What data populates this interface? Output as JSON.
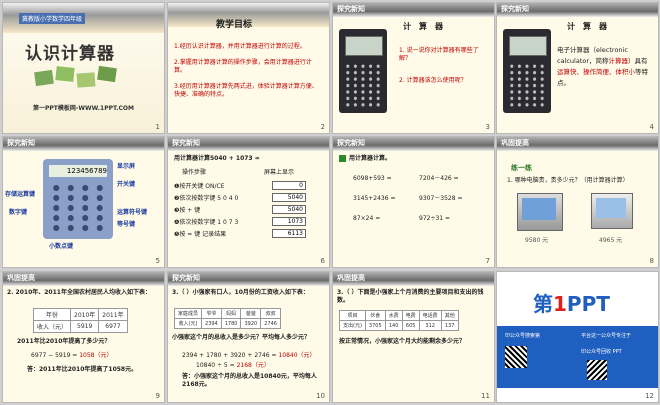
{
  "slides": [
    {
      "num": "1",
      "badge": "冀教版小学数学四年级",
      "title": "认识计算器",
      "footer": "第一PPT模板网-WWW.1PPT.COM"
    },
    {
      "num": "2",
      "title": "教学目标",
      "items": [
        "1.经历认识计算器，并用计算器进行计算的过程。",
        "2.掌握用计算器计算的操作步骤，会用计算器进行计算。",
        "3.经历用计算器计算先两式进，体验计算器计算方便、快捷、准确的特点。"
      ]
    },
    {
      "num": "3",
      "hdr": "探究新知",
      "title": "计　算　器",
      "q1": "1. 说一说你对计算器有哪些了解？",
      "q2": "2. 计算器该怎么使用呢？"
    },
    {
      "num": "4",
      "hdr": "探究新知",
      "title": "计　算　器",
      "text_a": "电子计算器（electronic calculator，简称",
      "text_b": "计算器",
      "text_c": "）具有",
      "text_d": "运算快、操作简便、体积小",
      "text_e": "等特点。"
    },
    {
      "num": "5",
      "hdr": "探究新知",
      "display": "123456789",
      "labels": {
        "screen": "显示屏",
        "power": "开关键",
        "memory": "存储运算键",
        "digit": "数字键",
        "op": "运算符号键",
        "eq": "等号键",
        "dot": "小数点键"
      }
    },
    {
      "num": "6",
      "hdr": "探究新知",
      "title": "用计算器计算5040 + 1073 =",
      "col1": "操作步骤",
      "col2": "屏幕上显示",
      "steps": [
        "❶按开关键 ON/CE",
        "❷依次按数字键 5 0 4 0",
        "❸按 + 键",
        "❹依次按数字键 1 0 7 3",
        "❺按 = 键 记录结果"
      ],
      "screens": [
        "0",
        "5040",
        "5040",
        "1073",
        "6113"
      ]
    },
    {
      "num": "7",
      "hdr": "探究新知",
      "sub": "用计算器计算。",
      "exprs": [
        "6098+593 =",
        "7204－426 =",
        "3145+2436 =",
        "9307－3528 =",
        "87×24 =",
        "972÷31 ="
      ]
    },
    {
      "num": "8",
      "hdr": "巩固提高",
      "sub": "练一练",
      "q": "1. 哪种电脑贵，贵多少元？（用计算器计算）",
      "prices": [
        "9580 元",
        "4965 元"
      ]
    },
    {
      "num": "9",
      "hdr": "巩固提高",
      "q": "2. 2010年、2011年全国农村居民人均收入如下表：",
      "thead": [
        "年份",
        "2010年",
        "2011年"
      ],
      "trow": [
        "收入（元）",
        "5919",
        "6977"
      ],
      "ask": "2011年比2010年提高了多少元？",
      "calc_a": "6977 − 5919 = ",
      "calc_b": "1058（元）",
      "ans": "答：2011年比2010年提高了1058元。"
    },
    {
      "num": "10",
      "hdr": "探究新知",
      "q": "3.（ ）小强家有口人，10月份的工资收入如下表：",
      "thead": [
        "家庭成员",
        "爷爷",
        "妈妈",
        "爸爸",
        "叔叔"
      ],
      "trow": [
        "收入(元)",
        "2394",
        "1780",
        "3920",
        "2746"
      ],
      "ask": "小强家这个月的总收入是多少元？平均每人多少元？",
      "line1a": "2394 + 1780 + 3920 + 2746 = ",
      "line1b": "10840（元）",
      "line2a": "10840 ÷ 5 = ",
      "line2b": "2168（元）",
      "ans": "答：小强家这个月的总收入是10840元，平均每人2168元。"
    },
    {
      "num": "11",
      "hdr": "巩固提高",
      "q": "3.（ ）下面是小强家上个月消费的主要项目和支出的钱数。",
      "thead": [
        "项目",
        "伙食",
        "水费",
        "电费",
        "电话费",
        "其他"
      ],
      "trow": [
        "支出(元)",
        "3705",
        "140",
        "605",
        "312",
        "137"
      ],
      "ask": "按正常情况，小强家这个月大约能剩余多少元？"
    },
    {
      "num": "12",
      "logo_a": "第",
      "logo_b": "1",
      "logo_c": "PPT",
      "info": [
        "印公众号搜索第",
        "平台这一公众号专注于",
        "印公众号回收 PPT"
      ]
    }
  ]
}
